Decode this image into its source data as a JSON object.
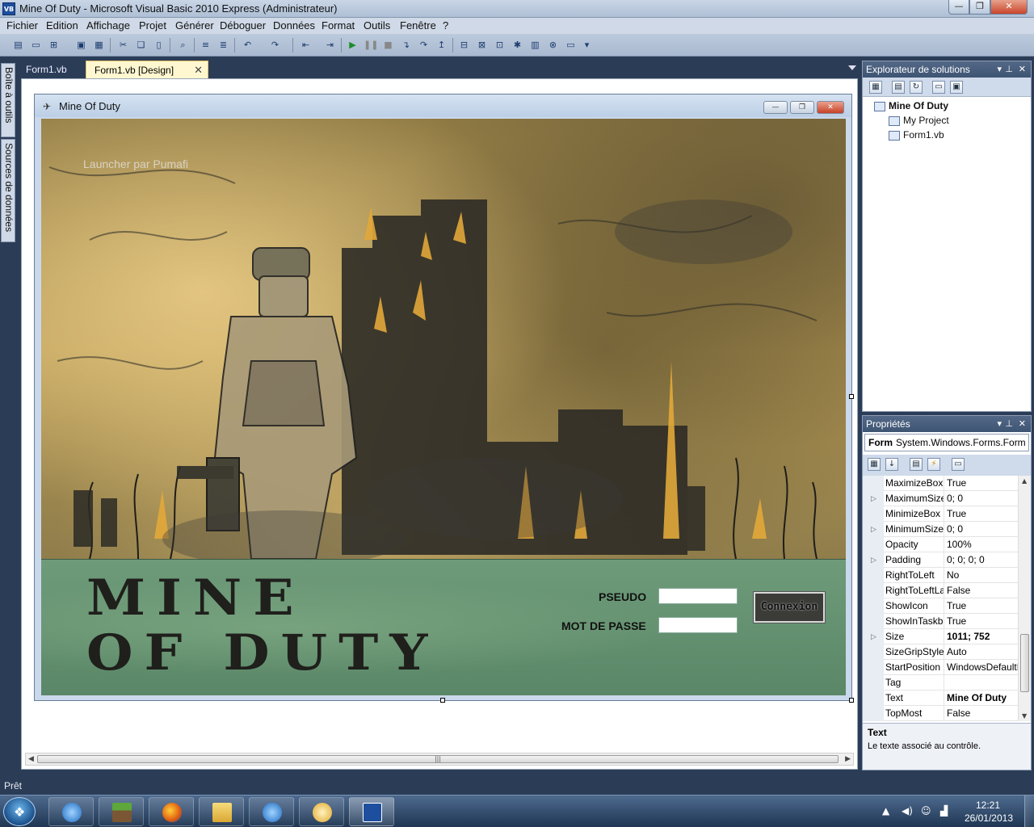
{
  "window": {
    "title": "Mine Of Duty - Microsoft Visual Basic 2010 Express (Administrateur)",
    "app_icon": "VB",
    "buttons": {
      "minimize": "—",
      "maximize": "❐",
      "close": "✕"
    }
  },
  "menu": [
    "Fichier",
    "Edition",
    "Affichage",
    "Projet",
    "Générer",
    "Déboguer",
    "Données",
    "Format",
    "Outils",
    "Fenêtre",
    "?"
  ],
  "left_strip": {
    "toolbox": "Boîte à outils",
    "datasources": "Sources de données"
  },
  "doc_tabs": [
    {
      "label": "Form1.vb"
    },
    {
      "label": "Form1.vb [Design]",
      "active": true
    }
  ],
  "form": {
    "title": "Mine Of Duty",
    "launcher_label": "Launcher par Pumafi",
    "logo_line1": "MINE",
    "logo_line2": "OF DUTY",
    "pseudo_label": "PSEUDO",
    "password_label": "MOT DE PASSE",
    "pseudo_value": "",
    "password_value": "",
    "connect_button": "Connexion"
  },
  "solution_explorer": {
    "title": "Explorateur de solutions",
    "items": [
      {
        "label": "Mine Of Duty",
        "bold": true
      },
      {
        "label": "My Project"
      },
      {
        "label": "Form1.vb"
      }
    ]
  },
  "properties": {
    "title": "Propriétés",
    "object_name": "Form",
    "object_type": "System.Windows.Forms.Form",
    "rows": [
      {
        "name": "MaximizeBox",
        "value": "True",
        "expand": false
      },
      {
        "name": "MaximumSize",
        "value": "0; 0",
        "expand": true
      },
      {
        "name": "MinimizeBox",
        "value": "True",
        "expand": false
      },
      {
        "name": "MinimumSize",
        "value": "0; 0",
        "expand": true
      },
      {
        "name": "Opacity",
        "value": "100%",
        "expand": false
      },
      {
        "name": "Padding",
        "value": "0; 0; 0; 0",
        "expand": true
      },
      {
        "name": "RightToLeft",
        "value": "No",
        "expand": false
      },
      {
        "name": "RightToLeftLayout",
        "value": "False",
        "expand": false
      },
      {
        "name": "ShowIcon",
        "value": "True",
        "expand": false
      },
      {
        "name": "ShowInTaskbar",
        "value": "True",
        "expand": false
      },
      {
        "name": "Size",
        "value": "1011; 752",
        "expand": true,
        "bold": true
      },
      {
        "name": "SizeGripStyle",
        "value": "Auto",
        "expand": false
      },
      {
        "name": "StartPosition",
        "value": "WindowsDefaultLocation",
        "expand": false
      },
      {
        "name": "Tag",
        "value": "",
        "expand": false
      },
      {
        "name": "Text",
        "value": "Mine Of Duty",
        "expand": false,
        "bold": true
      },
      {
        "name": "TopMost",
        "value": "False",
        "expand": false
      }
    ],
    "description_title": "Text",
    "description_text": "Le texte associé au contrôle."
  },
  "status": "Prêt",
  "taskbar": {
    "apps": [
      "itunes-icon",
      "minecraft-icon",
      "firefox-icon",
      "explorer-icon",
      "itunes2-icon",
      "messenger-icon",
      "vb-icon"
    ],
    "time": "12:21",
    "date": "26/01/2013"
  },
  "colors": {
    "ide_frame": "#2b3c57",
    "form_ground": "#b79a55",
    "panel_green": "#5a8767",
    "active_tab": "#fff7d0"
  }
}
